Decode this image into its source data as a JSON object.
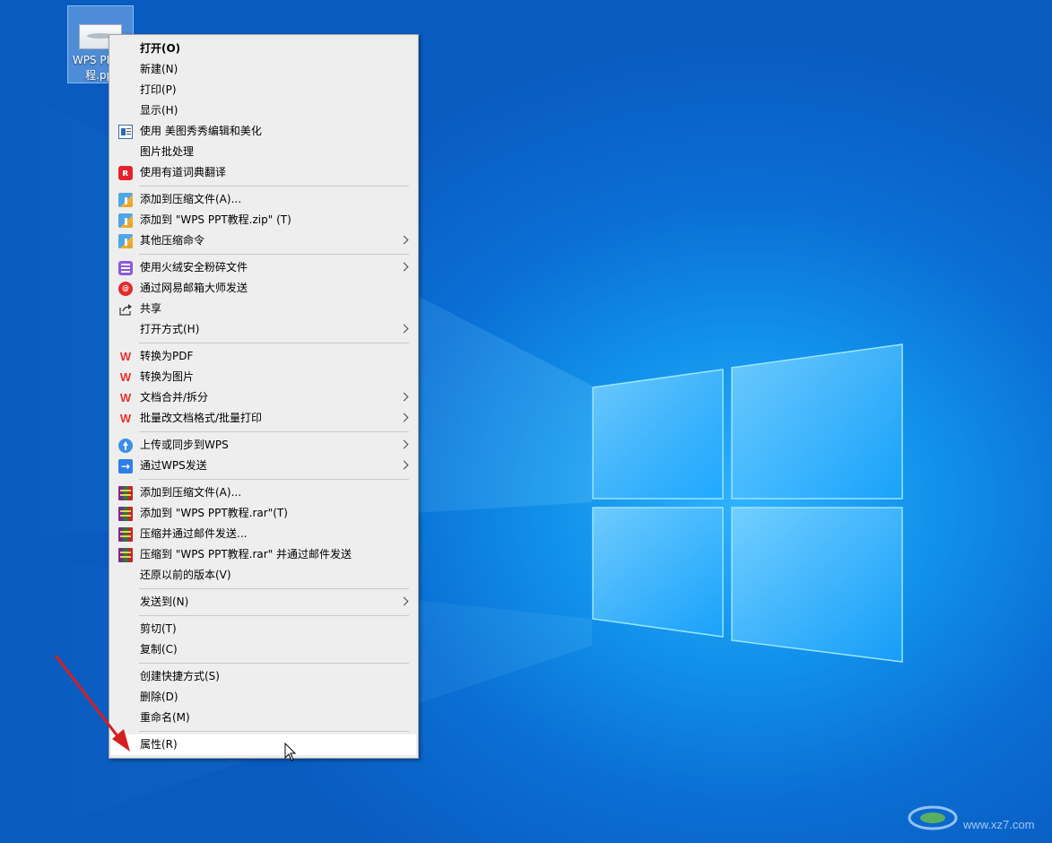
{
  "desktop": {
    "icon_label": "WPS PPT教程.ppt"
  },
  "menu": {
    "items": [
      {
        "label": "打开(O)",
        "icon": "none",
        "bold": true
      },
      {
        "label": "新建(N)",
        "icon": "none"
      },
      {
        "label": "打印(P)",
        "icon": "none"
      },
      {
        "label": "显示(H)",
        "icon": "none"
      },
      {
        "label": "使用 美图秀秀编辑和美化",
        "icon": "meitu-window-icon"
      },
      {
        "label": "图片批处理",
        "icon": "none"
      },
      {
        "label": "使用有道词典翻译",
        "icon": "youdao-icon"
      },
      {
        "label": "添加到压缩文件(A)...",
        "icon": "zip-icon"
      },
      {
        "label": "添加到 \"WPS PPT教程.zip\" (T)",
        "icon": "zip-icon"
      },
      {
        "label": "其他压缩命令",
        "icon": "zip-icon",
        "submenu": true
      },
      {
        "label": "使用火绒安全粉碎文件",
        "icon": "shredder-icon",
        "submenu": true
      },
      {
        "label": "通过网易邮箱大师发送",
        "icon": "netease-mail-icon"
      },
      {
        "label": "共享",
        "icon": "share-icon"
      },
      {
        "label": "打开方式(H)",
        "icon": "none",
        "submenu": true
      },
      {
        "label": "转换为PDF",
        "icon": "wps-icon"
      },
      {
        "label": "转换为图片",
        "icon": "wps-icon"
      },
      {
        "label": "文档合并/拆分",
        "icon": "wps-icon",
        "submenu": true
      },
      {
        "label": "批量改文档格式/批量打印",
        "icon": "wps-icon",
        "submenu": true
      },
      {
        "label": "上传或同步到WPS",
        "icon": "cloud-upload-icon",
        "submenu": true
      },
      {
        "label": "通过WPS发送",
        "icon": "send-icon",
        "submenu": true
      },
      {
        "label": "添加到压缩文件(A)...",
        "icon": "winrar-icon"
      },
      {
        "label": "添加到 \"WPS PPT教程.rar\"(T)",
        "icon": "winrar-icon"
      },
      {
        "label": "压缩并通过邮件发送...",
        "icon": "winrar-icon"
      },
      {
        "label": "压缩到 \"WPS PPT教程.rar\" 并通过邮件发送",
        "icon": "winrar-icon"
      },
      {
        "label": "还原以前的版本(V)",
        "icon": "none"
      },
      {
        "label": "发送到(N)",
        "icon": "none",
        "submenu": true
      },
      {
        "label": "剪切(T)",
        "icon": "none"
      },
      {
        "label": "复制(C)",
        "icon": "none"
      },
      {
        "label": "创建快捷方式(S)",
        "icon": "none"
      },
      {
        "label": "删除(D)",
        "icon": "none"
      },
      {
        "label": "重命名(M)",
        "icon": "none"
      },
      {
        "label": "属性(R)",
        "icon": "none",
        "highlighted": true
      }
    ]
  },
  "watermark": {
    "text": "www.xz7.com"
  },
  "colors": {
    "menu_bg": "#eeeeee",
    "annotation_arrow": "#d42020",
    "desktop_blue": "#1191ea"
  }
}
